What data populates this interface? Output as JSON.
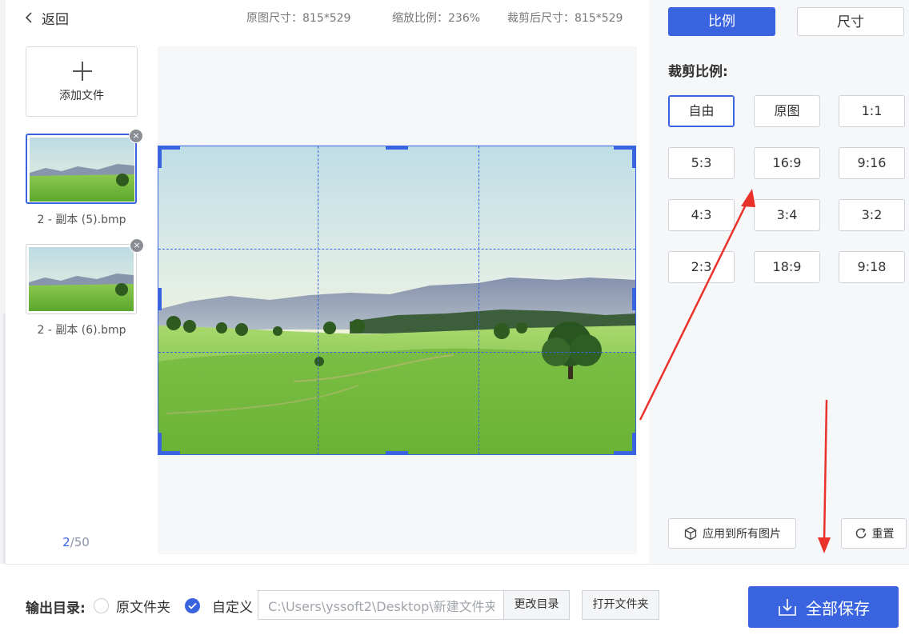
{
  "header": {
    "back_label": "返回",
    "original_size": "原图尺寸：815*529",
    "zoom_ratio": "缩放比例：236%",
    "cropped_size": "裁剪后尺寸：815*529"
  },
  "files": {
    "add_label": "添加文件",
    "items": [
      {
        "name": "2 - 副本 (5).bmp",
        "remove": "×"
      },
      {
        "name": "2 - 副本 (6).bmp",
        "remove": "×"
      }
    ],
    "pager_current": "2",
    "pager_total": "/50"
  },
  "panel": {
    "tabs": [
      {
        "label": "比例"
      },
      {
        "label": "尺寸"
      }
    ],
    "ratio_title": "裁剪比例:",
    "ratios": [
      "自由",
      "原图",
      "1:1",
      "5:3",
      "16:9",
      "9:16",
      "4:3",
      "3:4",
      "3:2",
      "2:3",
      "18:9",
      "9:18"
    ],
    "selected_ratio": "自由",
    "apply_all_label": "应用到所有图片",
    "reset_label": "重置"
  },
  "bottom": {
    "output_label": "输出目录:",
    "option_original": "原文件夹",
    "option_custom": "自定义",
    "path_value": "C:\\Users\\yssoft2\\Desktop\\新建文件夹",
    "change_dir_label": "更改目录",
    "open_folder_label": "打开文件夹",
    "save_all_label": "全部保存"
  },
  "colors": {
    "accent": "#3a63e0",
    "annotation_arrow": "#e8322a"
  }
}
